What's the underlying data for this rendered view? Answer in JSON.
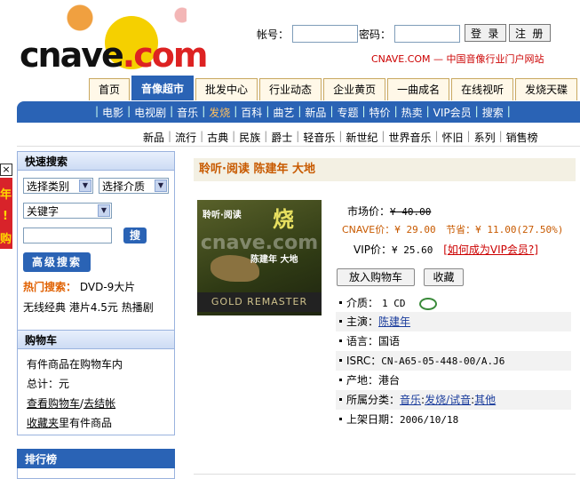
{
  "header": {
    "logo_text": "cnave",
    "logo_suffix": ".com",
    "account_label": "帐号：",
    "password_label": "密码：",
    "login_button": "登 录",
    "register_button": "注 册",
    "slogan": "CNAVE.COM — 中国音像行业门户网站"
  },
  "main_tabs": [
    "首页",
    "音像超市",
    "批发中心",
    "行业动态",
    "企业黄页",
    "一曲成名",
    "在线视听",
    "发烧天碟"
  ],
  "nav_items": [
    "电影",
    "电视剧",
    "音乐",
    "发烧",
    "百科",
    "曲艺",
    "新品",
    "专题",
    "特价",
    "热卖",
    "VIP会员",
    "搜索"
  ],
  "sub_items": [
    "新品",
    "流行",
    "古典",
    "民族",
    "爵士",
    "轻音乐",
    "新世纪",
    "世界音乐",
    "怀旧",
    "系列",
    "销售榜"
  ],
  "quick_search": {
    "title": "快速搜索",
    "category": "选择类别",
    "medium": "选择介质",
    "keyword": "关键字",
    "search_button": "搜",
    "advanced_button": "高级搜索",
    "hot_label": "热门搜索：",
    "hot_1": "DVD-9大片",
    "hot_2": "无线经典",
    "hot_3": "港片4.5元",
    "hot_4": "热播剧"
  },
  "cart": {
    "title": "购物车",
    "line1": "有件商品在购物车内",
    "line2": "总计：元",
    "view_cart": "查看购物车",
    "slash": "/",
    "checkout": "去结帐",
    "favorites": "收藏夹",
    "favorites_suffix": "里有件商品"
  },
  "ranking": {
    "title": "排行榜"
  },
  "ad": {
    "close": "×",
    "text1": "年",
    "text2": "!",
    "text3": "购"
  },
  "product": {
    "title": "聆听·阅读 陈建年 大地",
    "cover_title": "聆听·阅读",
    "cover_subtitle": "陈建年 大地",
    "cover_watermark": "cnave.com",
    "cover_badge": "GOLD REMASTER",
    "market_label": "市场价：",
    "market_price": "¥ 40.00",
    "cnave_label": "CNAVE价：",
    "cnave_price": "¥ 29.00",
    "save_label": "节省：",
    "save_value": "¥ 11.00(27.50%)",
    "vip_label": "VIP价：",
    "vip_price": "¥ 25.60",
    "vip_link": "如何成为VIP会员?",
    "add_cart": "放入购物车",
    "favorite": "收藏",
    "medium_label": "介质：",
    "medium_value": "1 CD",
    "artist_label": "主演：",
    "artist_value": "陈建年",
    "language_label": "语言：",
    "language_value": "国语",
    "isrc_label": "ISRC：",
    "isrc_value": "CN-A65-05-448-00/A.J6",
    "origin_label": "产地：",
    "origin_value": "港台",
    "category_label": "所属分类：",
    "category_1": "音乐",
    "category_2": "发烧/试音",
    "category_3": "其他",
    "colon": ":",
    "date_label": "上架日期：",
    "date_value": "2006/10/18"
  },
  "colors": {
    "nav_blue": "#2a63b5",
    "price_red": "#c00",
    "title_orange": "#c85a00"
  }
}
